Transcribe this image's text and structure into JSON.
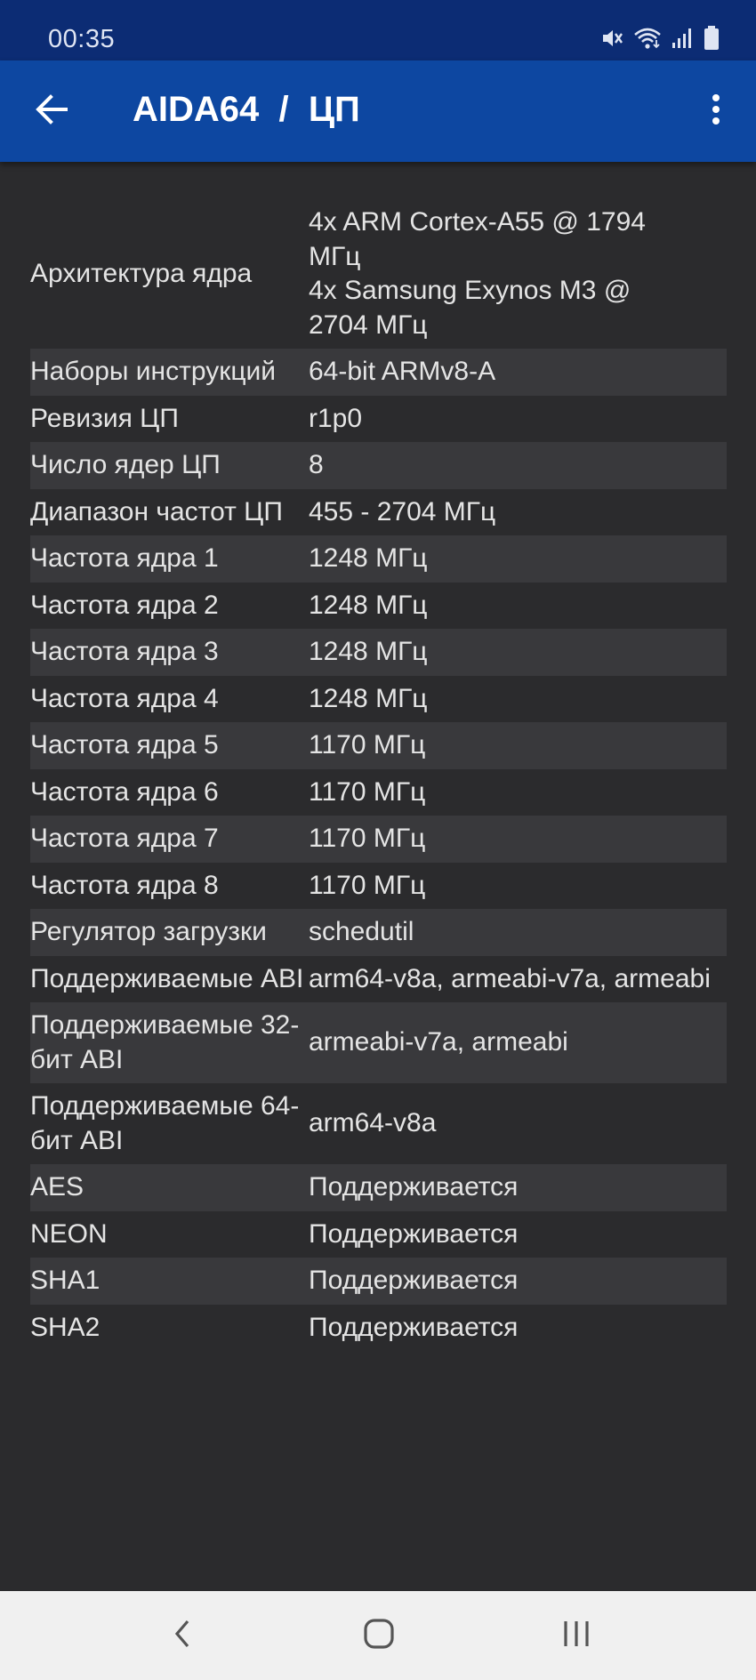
{
  "status_bar": {
    "time": "00:35",
    "icons": [
      "mute-icon",
      "wifi-icon",
      "signal-icon",
      "battery-icon"
    ]
  },
  "app_bar": {
    "title": "AIDA64  /  ЦП",
    "back_icon": "arrow-left-icon",
    "menu_icon": "more-vertical-icon",
    "color": "#0d47a1"
  },
  "rows": [
    {
      "label": "Архитектура ядра",
      "value": "4x ARM Cortex-A55 @ 1794 МГц\n4x Samsung Exynos M3 @ 2704 МГц"
    },
    {
      "label": "Наборы инструкций",
      "value": "64-bit ARMv8-A"
    },
    {
      "label": "Ревизия ЦП",
      "value": "r1p0"
    },
    {
      "label": "Число ядер ЦП",
      "value": "8"
    },
    {
      "label": "Диапазон частот ЦП",
      "value": "455 - 2704 МГц"
    },
    {
      "label": "Частота ядра 1",
      "value": "1248 МГц"
    },
    {
      "label": "Частота ядра 2",
      "value": "1248 МГц"
    },
    {
      "label": "Частота ядра 3",
      "value": "1248 МГц"
    },
    {
      "label": "Частота ядра 4",
      "value": "1248 МГц"
    },
    {
      "label": "Частота ядра 5",
      "value": "1170 МГц"
    },
    {
      "label": "Частота ядра 6",
      "value": "1170 МГц"
    },
    {
      "label": "Частота ядра 7",
      "value": "1170 МГц"
    },
    {
      "label": "Частота ядра 8",
      "value": "1170 МГц"
    },
    {
      "label": "Регулятор загрузки",
      "value": "schedutil"
    },
    {
      "label": "Поддерживаемые ABI",
      "value": "arm64-v8a, armeabi-v7a, armeabi"
    },
    {
      "label": "Поддерживаемые 32-бит ABI",
      "value": "armeabi-v7a, armeabi"
    },
    {
      "label": "Поддерживаемые 64-бит ABI",
      "value": "arm64-v8a"
    },
    {
      "label": "AES",
      "value": "Поддерживается"
    },
    {
      "label": "NEON",
      "value": "Поддерживается"
    },
    {
      "label": "SHA1",
      "value": "Поддерживается"
    },
    {
      "label": "SHA2",
      "value": "Поддерживается"
    }
  ],
  "nav_bar": {
    "buttons": [
      "back-icon",
      "home-icon",
      "recents-icon"
    ]
  }
}
